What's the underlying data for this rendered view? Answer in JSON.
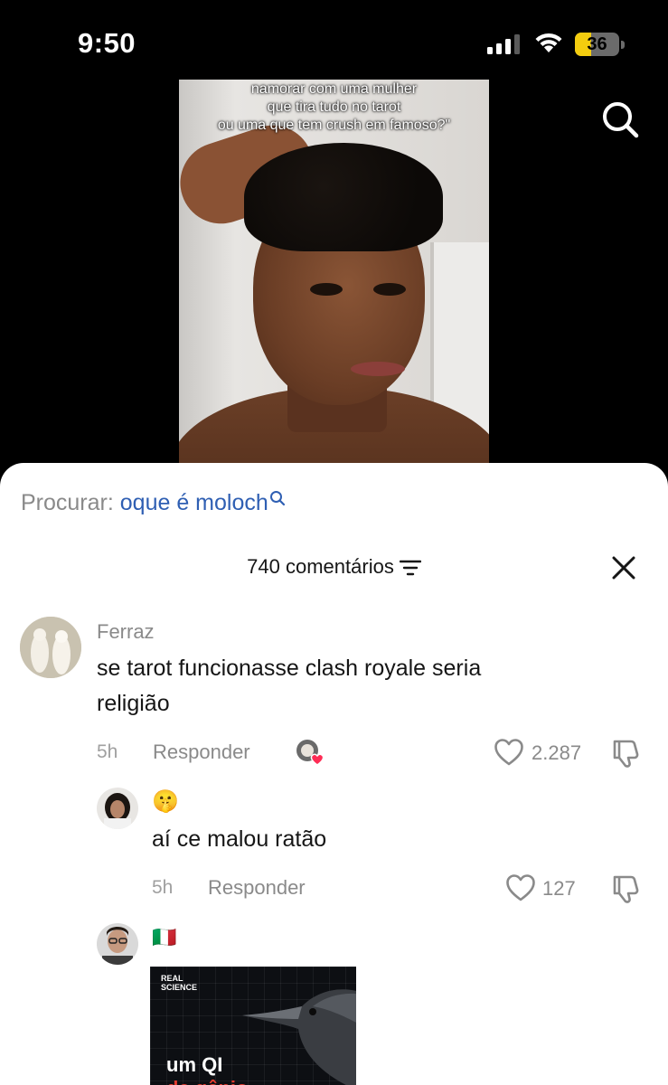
{
  "status_bar": {
    "time": "9:50",
    "battery": "36",
    "battery_level": 0.36
  },
  "video": {
    "caption_lines": [
      "namorar com uma mulher",
      "que tira tudo no tarot",
      "ou uma que tem crush em famoso?\""
    ]
  },
  "search_suggestion": {
    "label": "Procurar:",
    "term": "oque é moloch"
  },
  "comments_header": {
    "count_label": "740 comentários"
  },
  "comments": [
    {
      "username": "Ferraz",
      "text_lines": [
        "se tarot funcionasse clash royale seria",
        "religião"
      ],
      "time": "5h",
      "reply_label": "Responder",
      "likes": "2.287"
    },
    {
      "username": "🤫",
      "text_lines": [
        "aí ce malou ratão"
      ],
      "time": "5h",
      "reply_label": "Responder",
      "likes": "127"
    },
    {
      "username": "🇮🇹",
      "image": {
        "brand_line1": "REAL",
        "brand_line2": "SCIENCE",
        "headline_line1": "um QI",
        "headline_line2": "de gênio"
      }
    }
  ],
  "colors": {
    "accent_blue": "#2f5fb3",
    "like_heart": "#fe2c55",
    "battery_yellow": "#f4cd0f"
  }
}
